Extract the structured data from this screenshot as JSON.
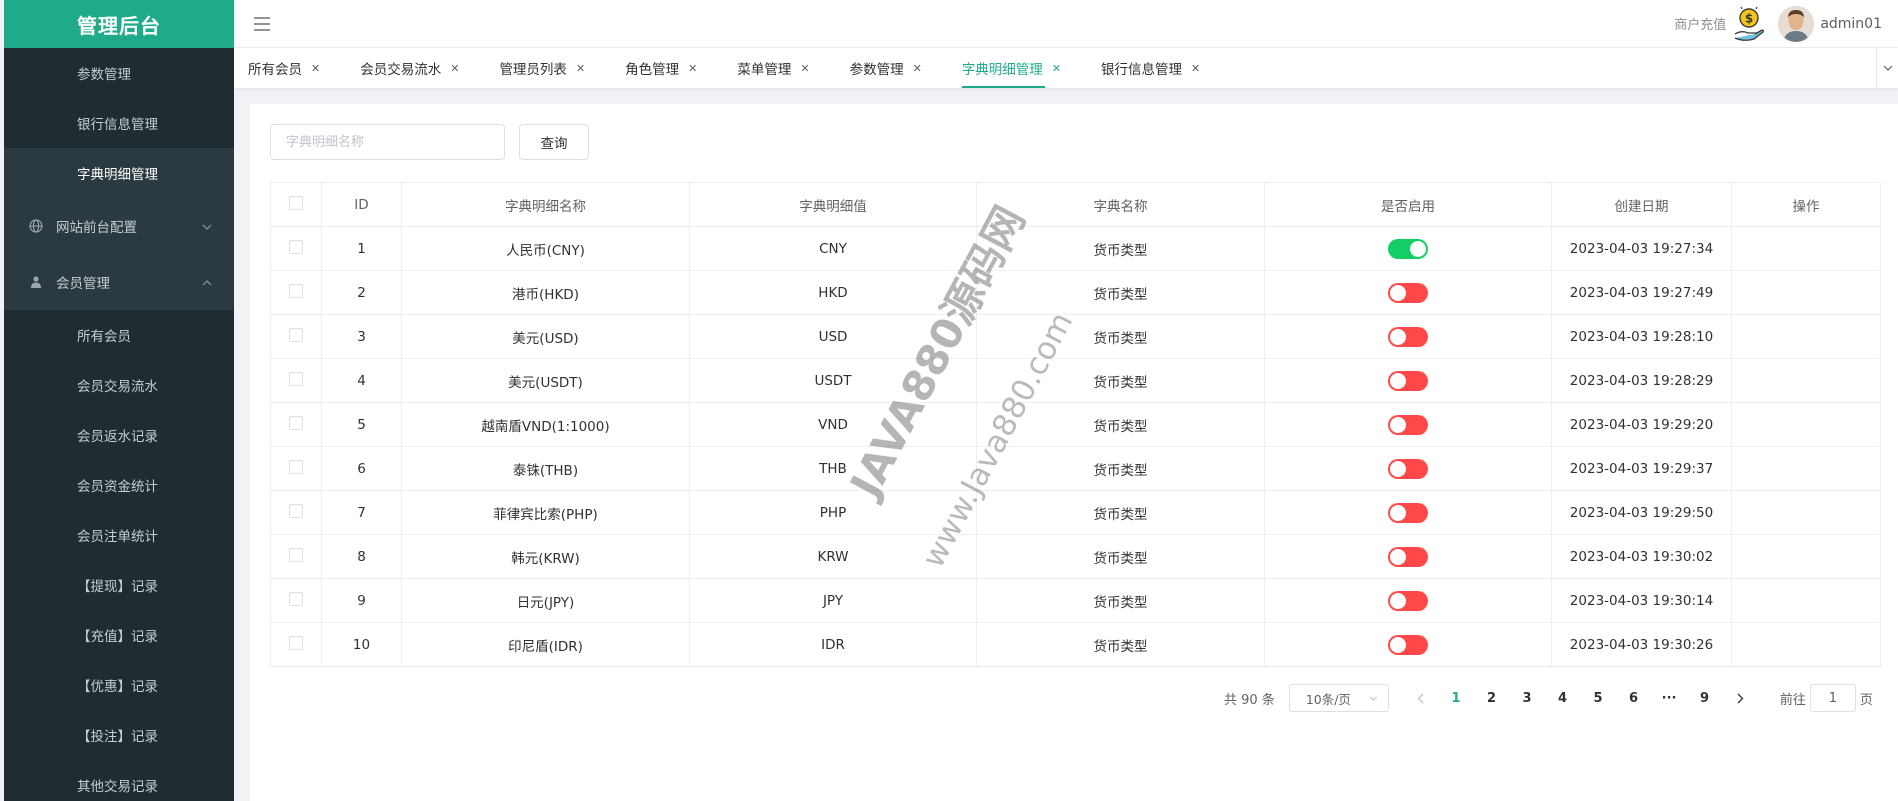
{
  "sidebar": {
    "logo": "管理后台",
    "items_top": [
      {
        "label": "参数管理",
        "active": false
      },
      {
        "label": "银行信息管理",
        "active": false
      },
      {
        "label": "字典明细管理",
        "active": true
      }
    ],
    "group_site": {
      "label": "网站前台配置",
      "icon": "globe-icon"
    },
    "group_member": {
      "label": "会员管理",
      "icon": "user-money-icon"
    },
    "member_items": [
      {
        "label": "所有会员"
      },
      {
        "label": "会员交易流水"
      },
      {
        "label": "会员返水记录"
      },
      {
        "label": "会员资金统计"
      },
      {
        "label": "会员注单统计"
      },
      {
        "label": "【提现】记录"
      },
      {
        "label": "【充值】记录"
      },
      {
        "label": "【优惠】记录"
      },
      {
        "label": "【投注】记录"
      },
      {
        "label": "其他交易记录"
      }
    ]
  },
  "header": {
    "recharge_label": "商户充值",
    "username": "admin01"
  },
  "tabs": [
    {
      "label": "所有会员",
      "active": false
    },
    {
      "label": "会员交易流水",
      "active": false
    },
    {
      "label": "管理员列表",
      "active": false
    },
    {
      "label": "角色管理",
      "active": false
    },
    {
      "label": "菜单管理",
      "active": false
    },
    {
      "label": "参数管理",
      "active": false
    },
    {
      "label": "字典明细管理",
      "active": true
    },
    {
      "label": "银行信息管理",
      "active": false
    }
  ],
  "search": {
    "placeholder": "字典明细名称",
    "button_label": "查询"
  },
  "table": {
    "headers": [
      "ID",
      "字典明细名称",
      "字典明细值",
      "字典名称",
      "是否启用",
      "创建日期",
      "操作"
    ],
    "rows": [
      {
        "id": "1",
        "name": "人民币(CNY)",
        "value": "CNY",
        "dict": "货币类型",
        "enabled": true,
        "created": "2023-04-03 19:27:34"
      },
      {
        "id": "2",
        "name": "港币(HKD)",
        "value": "HKD",
        "dict": "货币类型",
        "enabled": false,
        "created": "2023-04-03 19:27:49"
      },
      {
        "id": "3",
        "name": "美元(USD)",
        "value": "USD",
        "dict": "货币类型",
        "enabled": false,
        "created": "2023-04-03 19:28:10"
      },
      {
        "id": "4",
        "name": "美元(USDT)",
        "value": "USDT",
        "dict": "货币类型",
        "enabled": false,
        "created": "2023-04-03 19:28:29"
      },
      {
        "id": "5",
        "name": "越南盾VND(1:1000)",
        "value": "VND",
        "dict": "货币类型",
        "enabled": false,
        "created": "2023-04-03 19:29:20"
      },
      {
        "id": "6",
        "name": "泰铢(THB)",
        "value": "THB",
        "dict": "货币类型",
        "enabled": false,
        "created": "2023-04-03 19:29:37"
      },
      {
        "id": "7",
        "name": "菲律宾比索(PHP)",
        "value": "PHP",
        "dict": "货币类型",
        "enabled": false,
        "created": "2023-04-03 19:29:50"
      },
      {
        "id": "8",
        "name": "韩元(KRW)",
        "value": "KRW",
        "dict": "货币类型",
        "enabled": false,
        "created": "2023-04-03 19:30:02"
      },
      {
        "id": "9",
        "name": "日元(JPY)",
        "value": "JPY",
        "dict": "货币类型",
        "enabled": false,
        "created": "2023-04-03 19:30:14"
      },
      {
        "id": "10",
        "name": "印尼盾(IDR)",
        "value": "IDR",
        "dict": "货币类型",
        "enabled": false,
        "created": "2023-04-03 19:30:26"
      }
    ]
  },
  "pagination": {
    "total_text": "共 90 条",
    "page_size": "10条/页",
    "pages": [
      "1",
      "2",
      "3",
      "4",
      "5",
      "6",
      "···",
      "9"
    ],
    "current": "1",
    "goto_label": "前往",
    "goto_value": "1",
    "goto_suffix": "页"
  },
  "watermark": {
    "line1": "JAVA880源码网",
    "line2": "www.Java880.com"
  },
  "colors": {
    "brand": "#1fab8a",
    "sidebar_bg": "#2b3a40",
    "switch_on": "#13ce66",
    "switch_off": "#ff4949"
  }
}
